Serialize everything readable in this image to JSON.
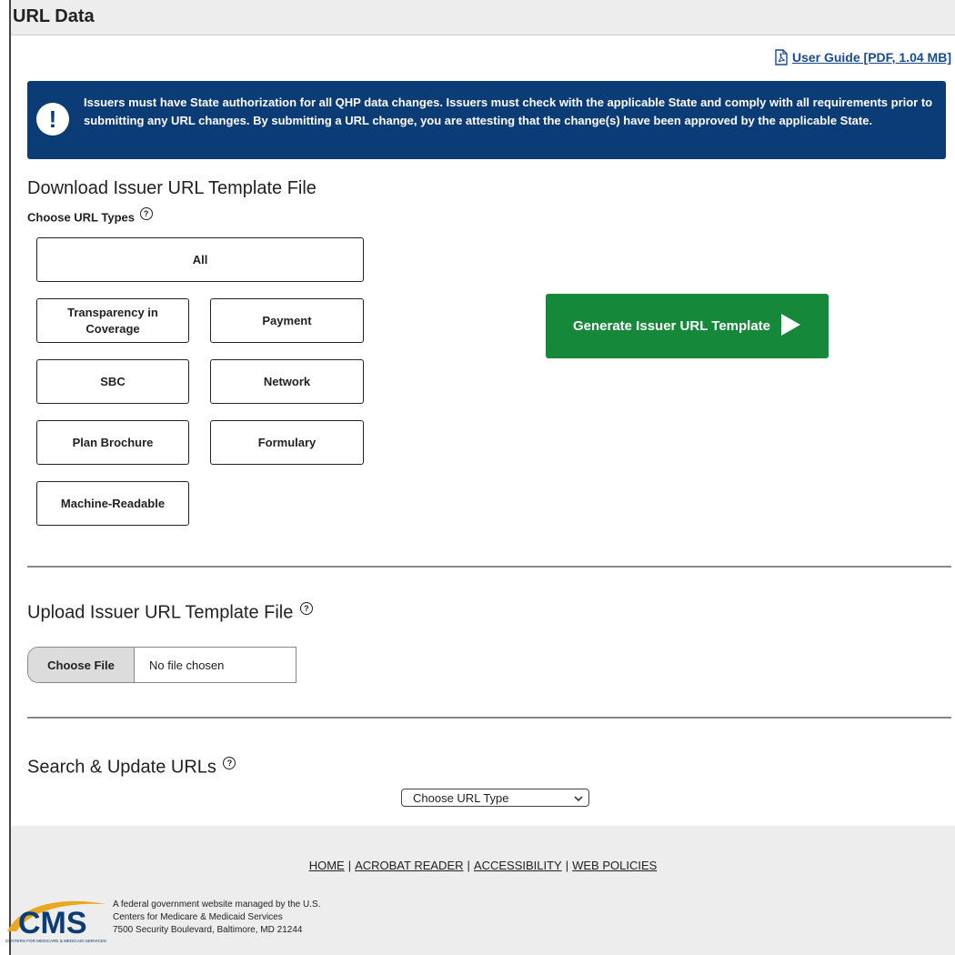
{
  "header": {
    "title": "URL Data"
  },
  "guide": {
    "label": "User Guide [PDF, 1.04 MB]"
  },
  "alert": {
    "icon": "exclamation-icon",
    "text": "Issuers must have State authorization for all QHP data changes. Issuers must check with the applicable State and comply with all requirements prior to submitting any URL changes. By submitting a URL change, you are attesting that the change(s) have been approved by the applicable State."
  },
  "download": {
    "heading": "Download Issuer URL Template File",
    "choose_label": "Choose URL Types",
    "types": {
      "all": "All",
      "transparency": "Transparency in Coverage",
      "payment": "Payment",
      "sbc": "SBC",
      "network": "Network",
      "plan_brochure": "Plan Brochure",
      "formulary": "Formulary",
      "machine_readable": "Machine-Readable"
    },
    "generate_label": "Generate Issuer URL Template"
  },
  "upload": {
    "heading": "Upload Issuer URL Template File",
    "choose_file": "Choose File",
    "no_file": "No file chosen"
  },
  "search": {
    "heading": "Search & Update URLs",
    "select_value": "Choose URL Type"
  },
  "footer": {
    "links": [
      "HOME",
      "ACROBAT READER",
      "ACCESSIBILITY",
      "WEB POLICIES"
    ],
    "logo_text": "CMS",
    "logo_subtext": "CENTERS FOR MEDICARE & MEDICAID SERVICES",
    "line1": "A federal government website managed by the U.S.",
    "line2": "Centers for Medicare & Medicaid Services",
    "line3": "7500 Security Boulevard, Baltimore, MD 21244"
  },
  "colors": {
    "alert_bg": "#0c3c75",
    "generate_bg": "#15883a",
    "link": "#1a4b8c"
  }
}
